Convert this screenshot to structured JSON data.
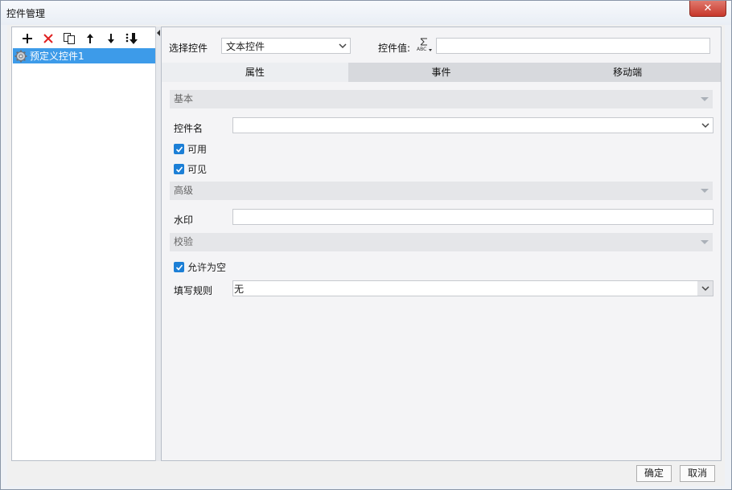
{
  "window": {
    "title": "控件管理",
    "close_glyph": "✕"
  },
  "toolbar": {
    "buttons": [
      {
        "name": "add-icon"
      },
      {
        "name": "delete-icon"
      },
      {
        "name": "copy-icon"
      },
      {
        "name": "move-up-icon"
      },
      {
        "name": "move-down-icon"
      },
      {
        "name": "move-bottom-icon"
      }
    ]
  },
  "tree": {
    "items": [
      {
        "label": "预定义控件1",
        "icon": "gear-icon"
      }
    ]
  },
  "header": {
    "select_label": "选择控件",
    "select_value": "文本控件",
    "value_label": "控件值:",
    "value_input": "",
    "formula_icon": "formula-icon"
  },
  "tabs": [
    {
      "label": "属性",
      "active": true
    },
    {
      "label": "事件",
      "active": false
    },
    {
      "label": "移动端",
      "active": false
    }
  ],
  "sections": {
    "basic": {
      "title": "基本",
      "name_label": "控件名",
      "name_value": "",
      "enabled_label": "可用",
      "enabled": true,
      "visible_label": "可见",
      "visible": true
    },
    "advanced": {
      "title": "高级",
      "watermark_label": "水印",
      "watermark_value": ""
    },
    "validation": {
      "title": "校验",
      "allow_empty_label": "允许为空",
      "allow_empty": true,
      "rule_label": "填写规则",
      "rule_value": "无"
    }
  },
  "footer": {
    "ok_label": "确定",
    "cancel_label": "取消"
  },
  "colors": {
    "selection": "#3d9be9",
    "checkbox": "#1c7fd6",
    "close": "#c7372b",
    "delete": "#e02020"
  }
}
